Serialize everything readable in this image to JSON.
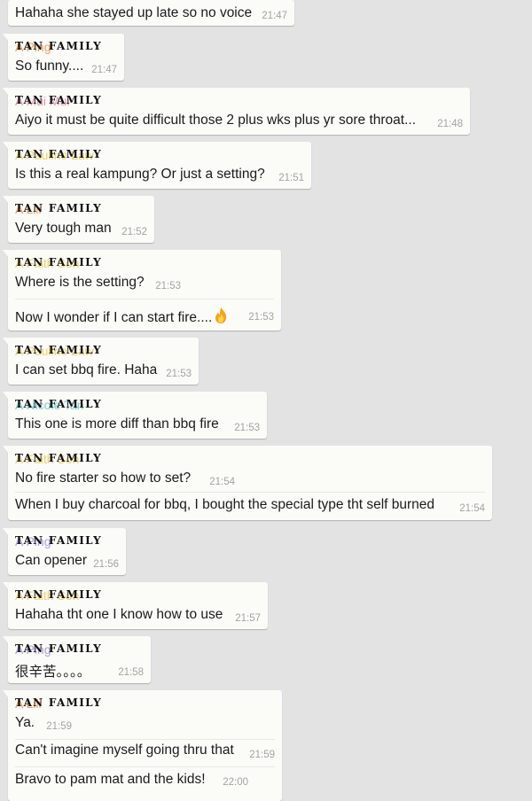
{
  "group_tag": "TAN FAMILY",
  "colors": {
    "background": "#e3e3e3",
    "bubble": "#fbfbf8",
    "timestamp": "#a3a3a3",
    "name_orange": "#e98a3a",
    "name_pink": "#e67aa0",
    "name_gold": "#e8c84a",
    "name_teal": "#59c4c8",
    "name_purple": "#9b86d9"
  },
  "messages": [
    {
      "sender": "",
      "text": "Hahaha she stayed up late so no voice",
      "time": "21:47"
    },
    {
      "sender": "A Ping",
      "text": "So funny....",
      "time": "21:47"
    },
    {
      "sender": "A Mui Mui",
      "text": "Aiyo it must be quite difficult those 2 plus wks plus yr sore throat...",
      "time": "21:48"
    },
    {
      "sender": "A Pauline Law",
      "text": "Is this a real kampung? Or just a setting?",
      "time": "21:51"
    },
    {
      "sender": "A Lili",
      "text": "Very tough man",
      "time": "21:52"
    },
    {
      "sender": "A Faith Soh",
      "text": "Where is the setting?",
      "time": "21:53"
    },
    {
      "sender": "",
      "text": "Now I wonder if I can start fire....",
      "time": "21:53",
      "emoji": "fire-emoji"
    },
    {
      "sender": "A Pauline Law",
      "text": "I can set bbq fire. Haha",
      "time": "21:53"
    },
    {
      "sender": "A Nicole Tan",
      "text": "This one is more diff than bbq fire",
      "time": "21:53"
    },
    {
      "sender": "A Faith Soh",
      "text": "No fire starter so how to set?",
      "time": "21:54"
    },
    {
      "sender": "",
      "text": "When I buy charcoal for bbq, I bought the special type tht self burned",
      "time": "21:54"
    },
    {
      "sender": "A Ping",
      "text": "Can opener",
      "time": "21:56"
    },
    {
      "sender": "A Faith Soh",
      "text": "Hahaha tht one I know how to use",
      "time": "21:57"
    },
    {
      "sender": "A Ping",
      "text": "很辛苦。。。。",
      "time": "21:58"
    },
    {
      "sender": "A Lili",
      "text": "Ya.",
      "time": "21:59"
    },
    {
      "sender": "",
      "text": "Can't imagine myself going thru that",
      "time": "21:59"
    },
    {
      "sender": "",
      "text": "Bravo to pam mat and the kids!",
      "time": "22:00"
    }
  ]
}
